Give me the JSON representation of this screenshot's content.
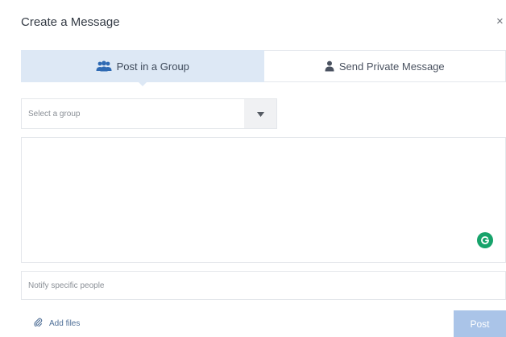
{
  "dialog": {
    "title": "Create a Message",
    "close_label": "×"
  },
  "tabs": [
    {
      "label": "Post in a Group",
      "icon": "group-icon",
      "active": true
    },
    {
      "label": "Send Private Message",
      "icon": "person-icon",
      "active": false
    }
  ],
  "group_select": {
    "placeholder": "Select a group"
  },
  "message": {
    "value": "",
    "assistant_icon": "grammarly-icon",
    "assistant_color": "#17a36b"
  },
  "notify": {
    "placeholder": "Notify specific people"
  },
  "footer": {
    "add_files_label": "Add files",
    "attach_icon": "paperclip-icon",
    "post_label": "Post",
    "post_color": "#aac4e8"
  },
  "colors": {
    "active_tab": "#dde8f5",
    "link": "#4f6f97",
    "border": "#e4e7eb"
  }
}
